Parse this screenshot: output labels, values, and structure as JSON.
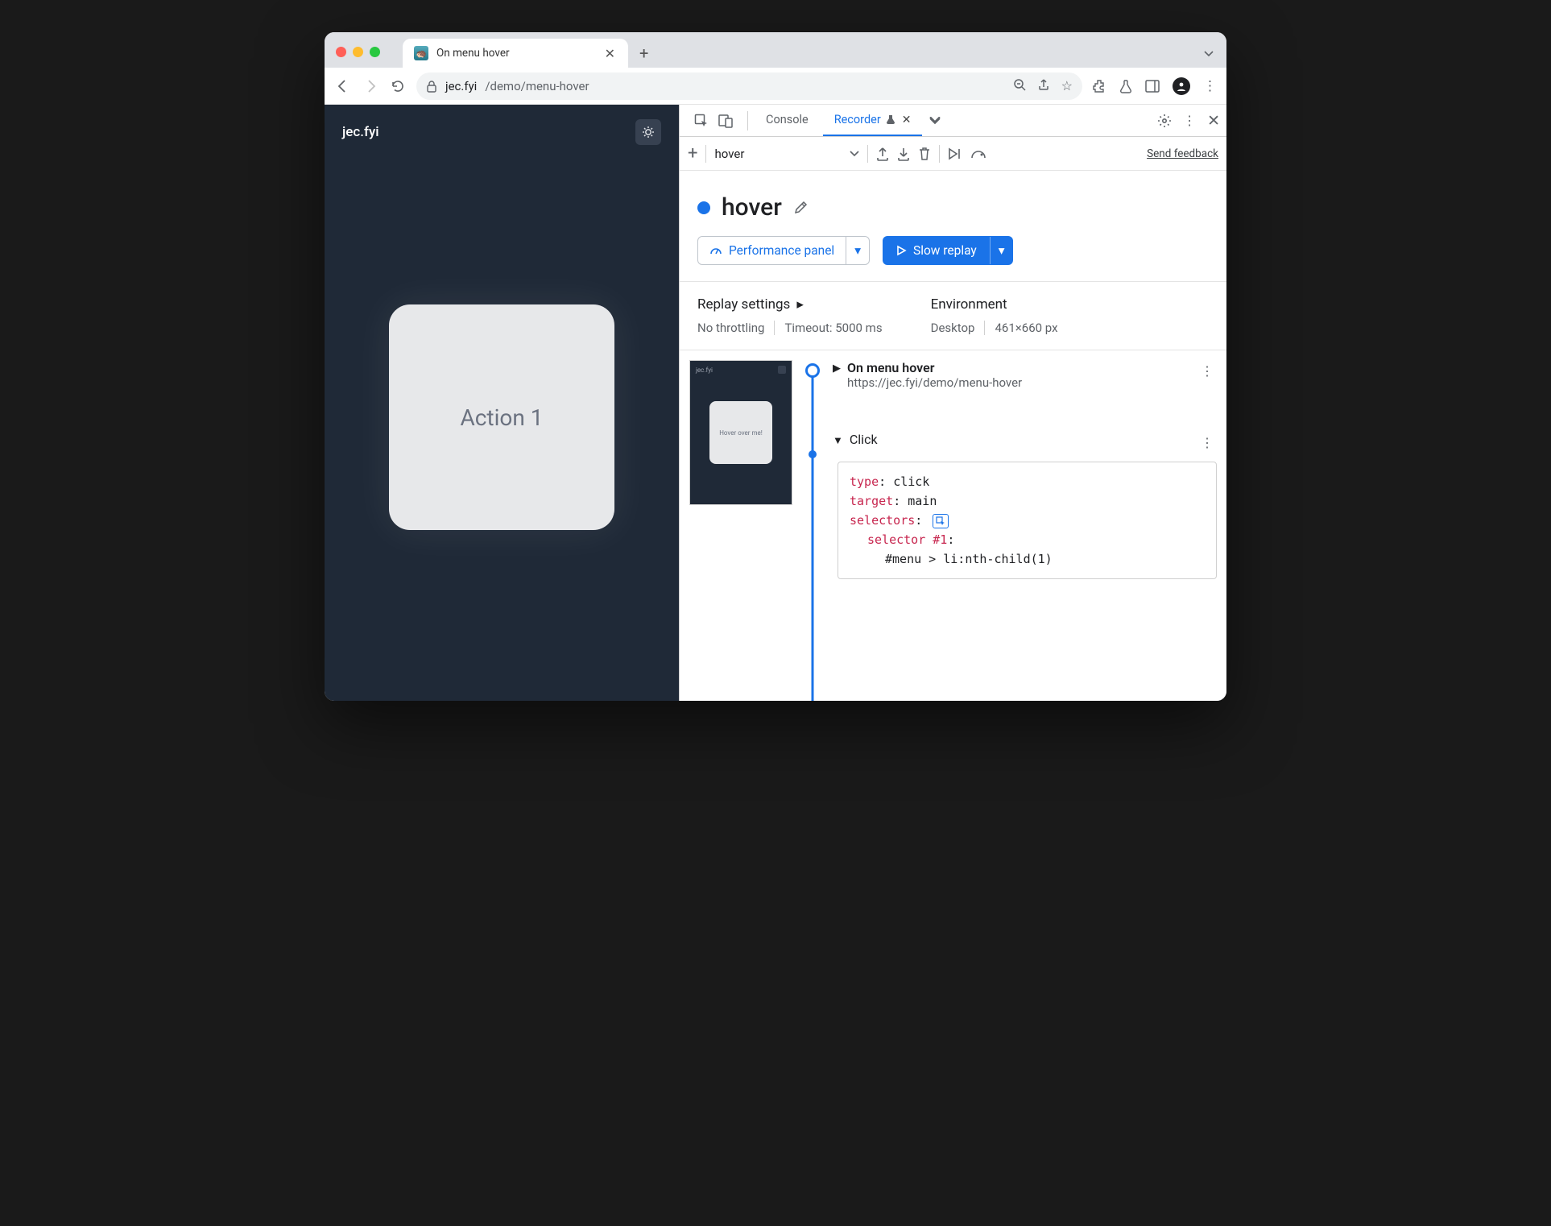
{
  "browser": {
    "tab_title": "On menu hover",
    "url_host": "jec.fyi",
    "url_path": "/demo/menu-hover"
  },
  "page": {
    "site_title": "jec.fyi",
    "card_text": "Action 1"
  },
  "devtools": {
    "tabs": {
      "console": "Console",
      "recorder": "Recorder"
    },
    "recorder": {
      "dropdown_value": "hover",
      "feedback": "Send feedback",
      "title": "hover",
      "perf_btn": "Performance panel",
      "replay_btn": "Slow replay",
      "settings": {
        "replay_label": "Replay settings",
        "throttling": "No throttling",
        "timeout": "Timeout: 5000 ms",
        "env_label": "Environment",
        "env_device": "Desktop",
        "env_viewport": "461×660 px"
      },
      "thumb": {
        "title": "jec.fyi",
        "card": "Hover over me!"
      },
      "steps": {
        "nav": {
          "title": "On menu hover",
          "url": "https://jec.fyi/demo/menu-hover"
        },
        "click": {
          "label": "Click",
          "type_k": "type",
          "type_v": "click",
          "target_k": "target",
          "target_v": "main",
          "selectors_k": "selectors",
          "selector_label": "selector #1",
          "selector_val": "#menu > li:nth-child(1)"
        }
      }
    }
  }
}
